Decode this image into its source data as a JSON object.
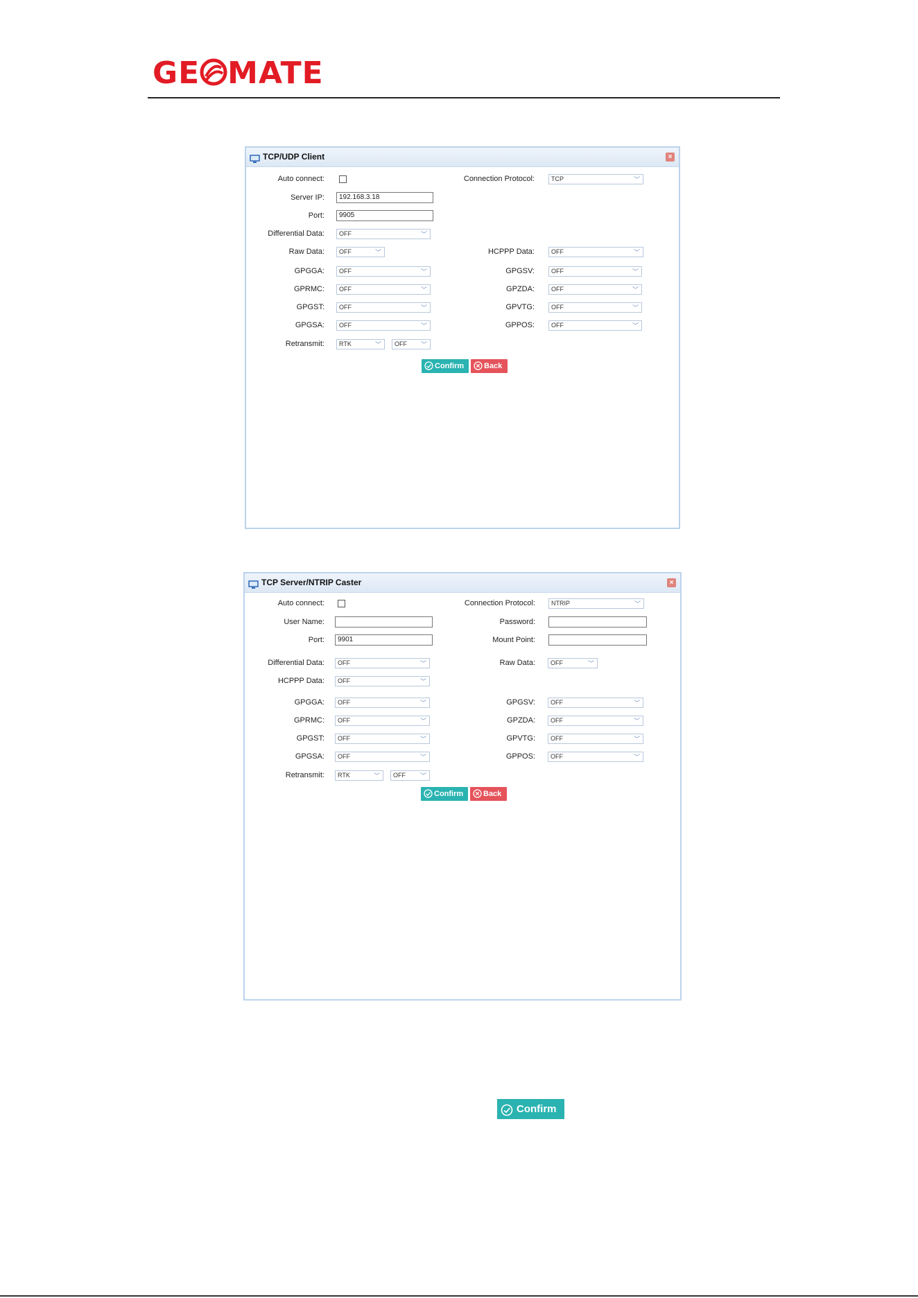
{
  "brand": {
    "logo_text_left": "GE",
    "logo_text_right": "MATE",
    "accent": "#e21b24"
  },
  "client": {
    "title": "TCP/UDP Client",
    "auto_connect_label": "Auto connect:",
    "connection_protocol_label": "Connection Protocol:",
    "connection_protocol_value": "TCP",
    "server_ip_label": "Server IP:",
    "server_ip_value": "192.168.3.18",
    "port_label": "Port:",
    "port_value": "9905",
    "differential_label": "Differential Data:",
    "differential_value": "OFF",
    "raw_label": "Raw Data:",
    "raw_value": "OFF",
    "hcppp_label": "HCPPP Data:",
    "hcppp_value": "OFF",
    "left_fields": [
      {
        "label": "GPGGA:",
        "value": "OFF"
      },
      {
        "label": "GPRMC:",
        "value": "OFF"
      },
      {
        "label": "GPGST:",
        "value": "OFF"
      },
      {
        "label": "GPGSA:",
        "value": "OFF"
      }
    ],
    "right_fields": [
      {
        "label": "GPGSV:",
        "value": "OFF"
      },
      {
        "label": "GPZDA:",
        "value": "OFF"
      },
      {
        "label": "GPVTG:",
        "value": "OFF"
      },
      {
        "label": "GPPOS:",
        "value": "OFF"
      }
    ],
    "retransmit_label": "Retransmit:",
    "retransmit_type": "RTK",
    "retransmit_value": "OFF",
    "confirm_label": "Confirm",
    "back_label": "Back"
  },
  "server": {
    "title": "TCP Server/NTRIP Caster",
    "auto_connect_label": "Auto connect:",
    "connection_protocol_label": "Connection Protocol:",
    "connection_protocol_value": "NTRIP",
    "user_name_label": "User Name:",
    "user_name_value": "",
    "password_label": "Password:",
    "password_value": "",
    "port_label": "Port:",
    "port_value": "9901",
    "mount_point_label": "Mount Point:",
    "mount_point_value": "",
    "differential_label": "Differential Data:",
    "differential_value": "OFF",
    "raw_label": "Raw Data:",
    "raw_value": "OFF",
    "hcppp_label": "HCPPP Data:",
    "hcppp_value": "OFF",
    "left_fields": [
      {
        "label": "GPGGA:",
        "value": "OFF"
      },
      {
        "label": "GPRMC:",
        "value": "OFF"
      },
      {
        "label": "GPGST:",
        "value": "OFF"
      },
      {
        "label": "GPGSA:",
        "value": "OFF"
      }
    ],
    "right_fields": [
      {
        "label": "GPGSV:",
        "value": "OFF"
      },
      {
        "label": "GPZDA:",
        "value": "OFF"
      },
      {
        "label": "GPVTG:",
        "value": "OFF"
      },
      {
        "label": "GPPOS:",
        "value": "OFF"
      }
    ],
    "retransmit_label": "Retransmit:",
    "retransmit_type": "RTK",
    "retransmit_value": "OFF",
    "confirm_label": "Confirm",
    "back_label": "Back"
  },
  "standalone_confirm_label": "Confirm",
  "colors": {
    "confirm": "#2ab3b1",
    "back": "#e5535b",
    "window_border": "#bcd2ec"
  }
}
